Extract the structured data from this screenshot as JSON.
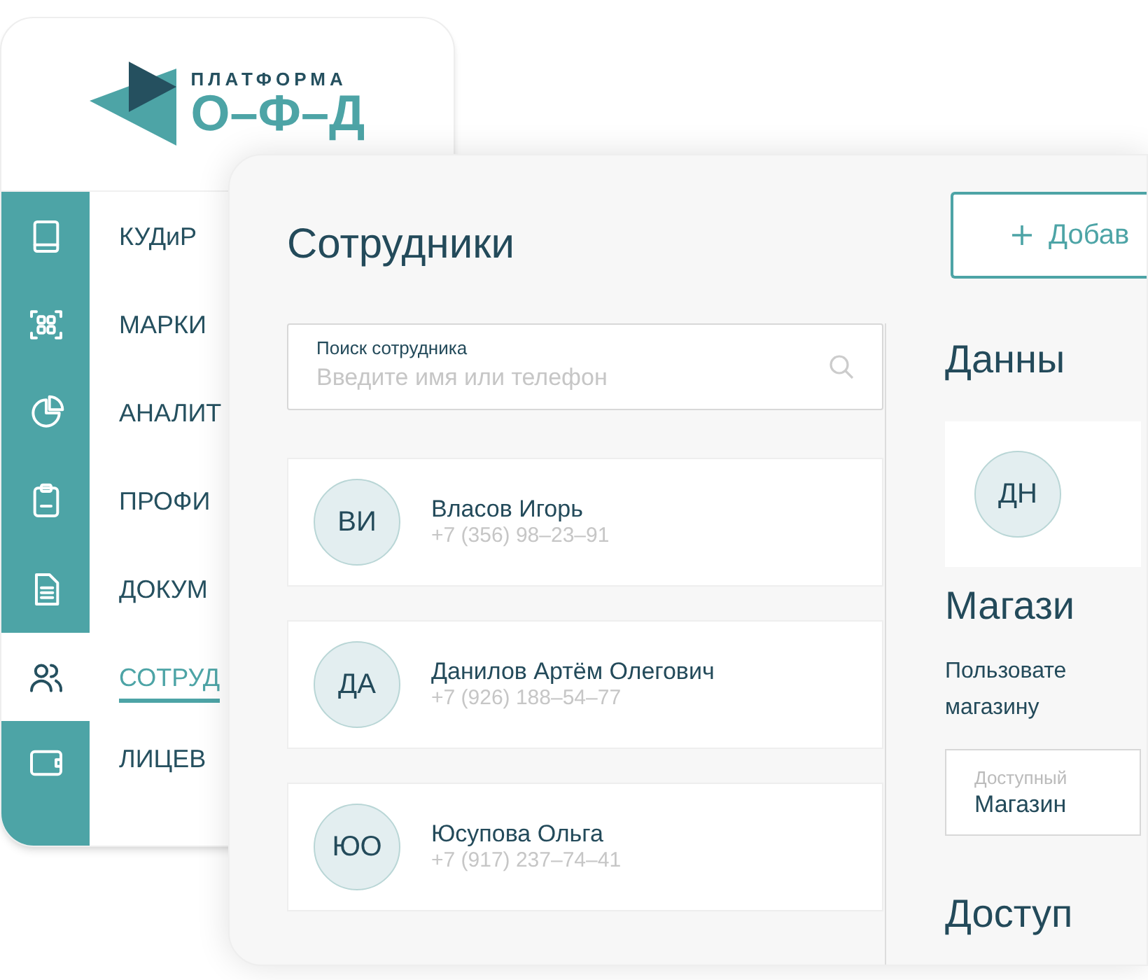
{
  "logo": {
    "top_line": "ПЛАТФОРМА",
    "bottom_line": "О–Ф–Д"
  },
  "nav": [
    {
      "label": "КУДиР",
      "selected": false
    },
    {
      "label": "МАРКИ",
      "selected": false
    },
    {
      "label": "АНАЛИТ",
      "selected": false
    },
    {
      "label": "ПРОФИ",
      "selected": false
    },
    {
      "label": "ДОКУМ",
      "selected": false
    },
    {
      "label": "СОТРУД",
      "selected": true
    },
    {
      "label": "ЛИЦЕВ",
      "selected": false
    }
  ],
  "page": {
    "title": "Сотрудники",
    "add_button": "Добав",
    "search": {
      "label": "Поиск сотрудника",
      "placeholder": "Введите имя или телефон"
    },
    "employees": [
      {
        "initials": "ВИ",
        "name": "Власов Игорь",
        "phone": "+7 (356) 98–23–91"
      },
      {
        "initials": "ДА",
        "name": "Данилов Артём Олегович",
        "phone": "+7 (926) 188–54–77"
      },
      {
        "initials": "ЮО",
        "name": "Юсупова Ольга",
        "phone": "+7 (917) 237–74–41"
      }
    ],
    "details": {
      "title": "Данны",
      "avatar_initials": "ДН",
      "store_heading": "Магази",
      "store_text": [
        "Пользовате",
        "магазину"
      ],
      "store_field": {
        "label": "Доступный",
        "value": "Магазин"
      },
      "access_heading": "Доступ"
    }
  }
}
